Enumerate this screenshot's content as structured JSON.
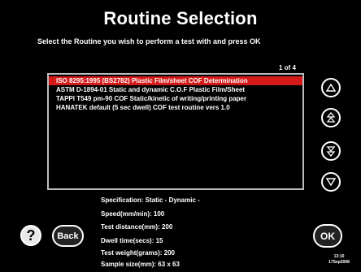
{
  "title": "Routine Selection",
  "instruction": "Select the Routine you wish to perform a test with and press OK",
  "page_indicator": "1 of 4",
  "routines": [
    "ISO 8295:1995 (BS2782) Plastic Film/sheet COF Determination",
    "ASTM D-1894-01 Static and dynamic C.O.F Plastic Film/Sheet",
    "TAPPI T549 pm-90 COF Static/kinetic of writing/printing paper",
    "HANATEK default (5 sec dwell) COF test routine vers 1.0"
  ],
  "selected_index": 0,
  "scroll_buttons": [
    "triangle-up-icon",
    "double-triangle-up-icon",
    "double-triangle-down-icon",
    "triangle-down-icon"
  ],
  "specification": {
    "line1": "Specification: Static -  Dynamic -",
    "speed": "Speed(mm/min): 100",
    "distance": "Test distance(mm): 200",
    "dwell": "Dwell time(secs): 15",
    "weight": "Test weight(grams): 200",
    "sample": "Sample size(mm): 63 x 63"
  },
  "buttons": {
    "help": "?",
    "back": "Back",
    "ok": "OK"
  },
  "clock": {
    "time": "13:10",
    "date": "17Sep2008"
  },
  "colors": {
    "background": "#000000",
    "selection": "#d41919",
    "text": "#ffffff"
  }
}
